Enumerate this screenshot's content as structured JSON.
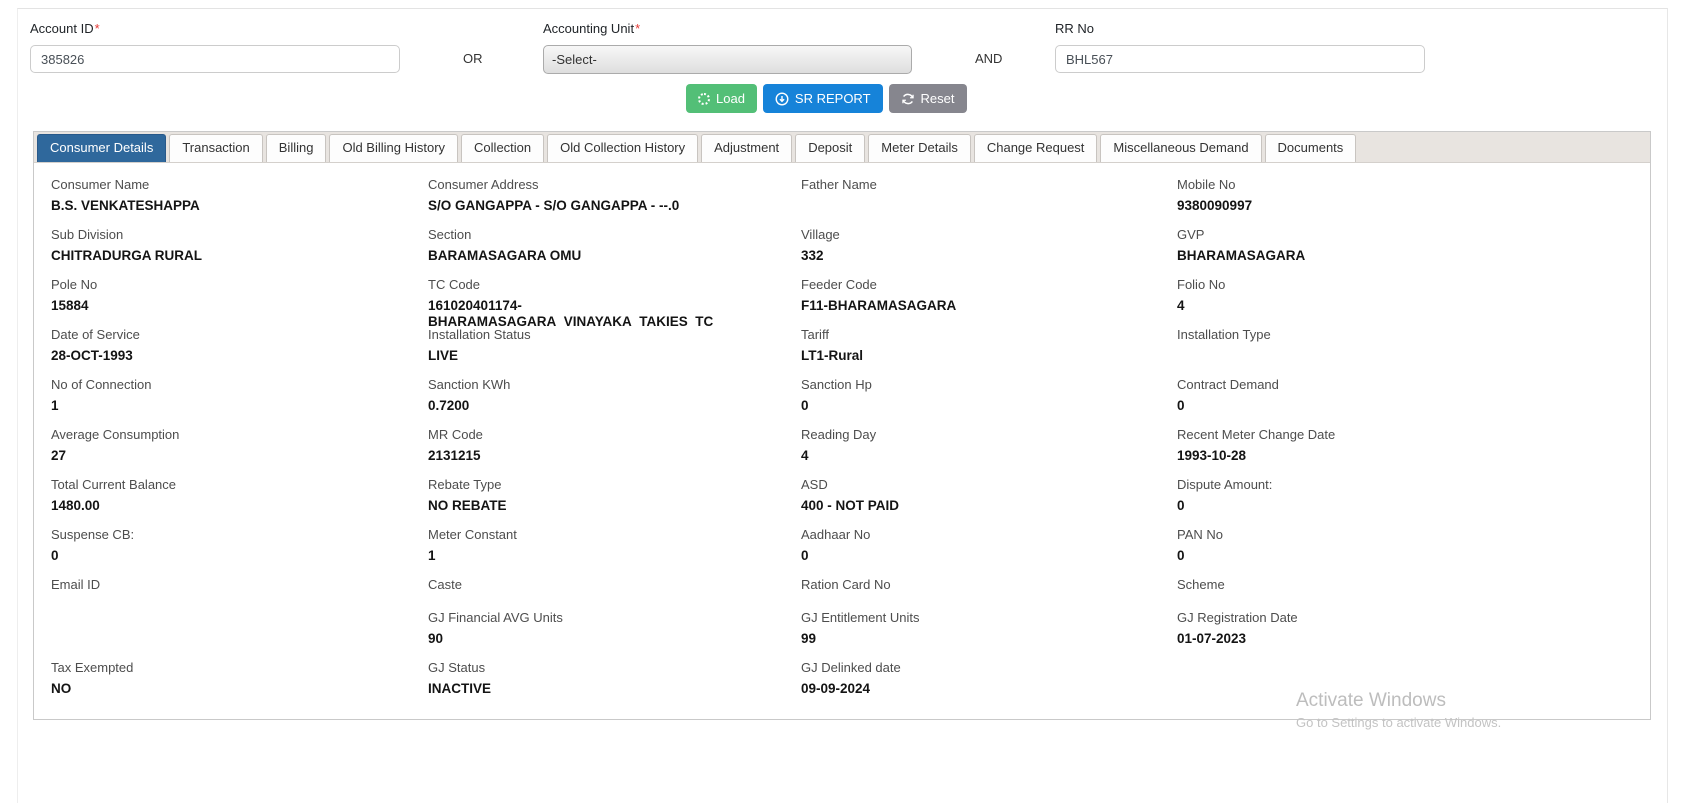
{
  "search_form": {
    "account_id": {
      "label": "Account ID",
      "required_mark": "*",
      "value": "385826"
    },
    "or_label": "OR",
    "accounting_unit": {
      "label": "Accounting Unit",
      "required_mark": "*",
      "selected_option": "-Select-"
    },
    "and_label": "AND",
    "rr_no": {
      "label": "RR No",
      "value": "BHL567"
    },
    "buttons": {
      "load": "Load",
      "sr_report": "SR REPORT",
      "reset": "Reset"
    }
  },
  "tabs": [
    {
      "label": "Consumer Details",
      "active": true
    },
    {
      "label": "Transaction",
      "active": false
    },
    {
      "label": "Billing",
      "active": false
    },
    {
      "label": "Old Billing History",
      "active": false
    },
    {
      "label": "Collection",
      "active": false
    },
    {
      "label": "Old Collection History",
      "active": false
    },
    {
      "label": "Adjustment",
      "active": false
    },
    {
      "label": "Deposit",
      "active": false
    },
    {
      "label": "Meter Details",
      "active": false
    },
    {
      "label": "Change Request",
      "active": false
    },
    {
      "label": "Miscellaneous Demand",
      "active": false
    },
    {
      "label": "Documents",
      "active": false
    }
  ],
  "consumer_details": {
    "rows": [
      [
        {
          "label": "Consumer Name",
          "value": "B.S. VENKATESHAPPA"
        },
        {
          "label": "Consumer Address",
          "value": "S/O GANGAPPA - S/O GANGAPPA - --.0"
        },
        {
          "label": "Father Name",
          "value": ""
        },
        {
          "label": "Mobile No",
          "value": "9380090997"
        }
      ],
      [
        {
          "label": "Sub Division",
          "value": "CHITRADURGA RURAL"
        },
        {
          "label": "Section",
          "value": "BARAMASAGARA OMU"
        },
        {
          "label": "Village",
          "value": "332"
        },
        {
          "label": "GVP",
          "value": "BHARAMASAGARA"
        }
      ],
      [
        {
          "label": "Pole No",
          "value": "15884"
        },
        {
          "label": "TC Code",
          "value": "161020401174-BHARAMASAGARA_VINAYAKA_TAKIES_TC"
        },
        {
          "label": "Feeder Code",
          "value": "F11-BHARAMASAGARA"
        },
        {
          "label": "Folio No",
          "value": "4"
        }
      ],
      [
        {
          "label": "Date of Service",
          "value": "28-OCT-1993"
        },
        {
          "label": "Installation Status",
          "value": "LIVE"
        },
        {
          "label": "Tariff",
          "value": "LT1-Rural"
        },
        {
          "label": "Installation Type",
          "value": ""
        }
      ],
      [
        {
          "label": "No of Connection",
          "value": "1"
        },
        {
          "label": "Sanction KWh",
          "value": "0.7200"
        },
        {
          "label": "Sanction Hp",
          "value": "0"
        },
        {
          "label": "Contract Demand",
          "value": "0"
        }
      ],
      [
        {
          "label": "Average Consumption",
          "value": "27"
        },
        {
          "label": "MR Code",
          "value": "2131215"
        },
        {
          "label": "Reading Day",
          "value": "4"
        },
        {
          "label": "Recent Meter Change Date",
          "value": "1993-10-28"
        }
      ],
      [
        {
          "label": "Total Current Balance",
          "value": "1480.00"
        },
        {
          "label": "Rebate Type",
          "value": "NO REBATE"
        },
        {
          "label": "ASD",
          "value": "400 - NOT PAID"
        },
        {
          "label": "Dispute Amount:",
          "value": "0"
        }
      ],
      [
        {
          "label": "Suspense CB:",
          "value": "0"
        },
        {
          "label": "Meter Constant",
          "value": "1"
        },
        {
          "label": "Aadhaar No",
          "value": "0"
        },
        {
          "label": "PAN No",
          "value": "0"
        }
      ],
      [
        {
          "label": "Email ID",
          "value": ""
        },
        {
          "label": "Caste",
          "value": ""
        },
        {
          "label": "Ration Card No",
          "value": ""
        },
        {
          "label": "Scheme",
          "value": ""
        }
      ],
      [
        {
          "label": "",
          "value": ""
        },
        {
          "label": "GJ Financial AVG Units",
          "value": "90"
        },
        {
          "label": "GJ Entitlement Units",
          "value": "99"
        },
        {
          "label": "GJ Registration Date",
          "value": "01-07-2023"
        }
      ],
      [
        {
          "label": "Tax Exempted",
          "value": "NO"
        },
        {
          "label": "GJ Status",
          "value": "INACTIVE"
        },
        {
          "label": "GJ Delinked date",
          "value": "09-09-2024"
        },
        {
          "label": "",
          "value": ""
        }
      ]
    ]
  },
  "watermark": {
    "line1": "Activate Windows",
    "line2": "Go to Settings to activate Windows."
  },
  "colors": {
    "load_green": "#53bf77",
    "report_blue": "#1683d9",
    "reset_gray": "#86868e",
    "tab_active_blue": "#2f689c",
    "required_red": "#e53935"
  }
}
